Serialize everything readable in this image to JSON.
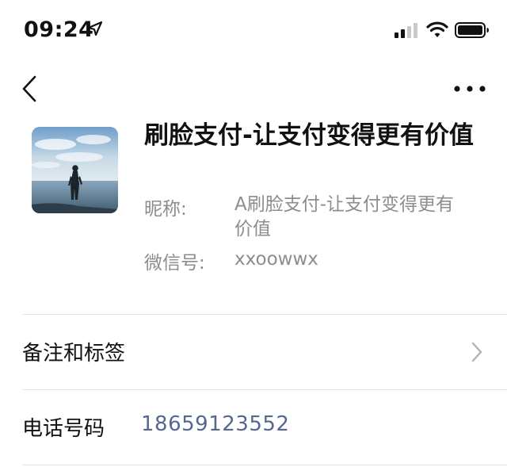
{
  "status_bar": {
    "time": "09:24"
  },
  "profile": {
    "name": "刷脸支付-让支付变得更有价值",
    "nickname_label": "昵称:",
    "nickname_value": "A刷脸支付-让支付变得更有价值",
    "wechat_id_label": "微信号:",
    "wechat_id_value": "xxoowwx"
  },
  "rows": {
    "remarks_label": "备注和标签",
    "phone_label": "电话号码",
    "phone_value": "18659123552"
  },
  "icons": {
    "back": "chevron-left-icon",
    "more": "more-dots-icon",
    "row_arrow": "chevron-right-icon"
  }
}
